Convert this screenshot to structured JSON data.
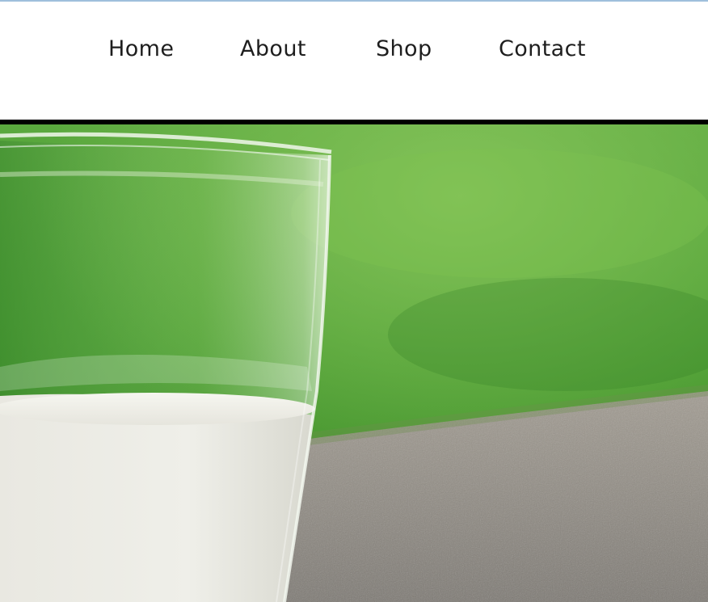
{
  "nav": {
    "items": [
      {
        "label": "Home"
      },
      {
        "label": "About"
      },
      {
        "label": "Shop"
      },
      {
        "label": "Contact"
      }
    ]
  },
  "hero": {
    "image": "glass-of-milk-on-stone-ledge-grass-background"
  },
  "colors": {
    "accent_rule": "#9fbfdc",
    "nav_text": "#1e1e1e",
    "hero_border": "#000000",
    "grass": "#4aa638",
    "stone": "#8f8b85",
    "milk": "#eeeee8"
  }
}
